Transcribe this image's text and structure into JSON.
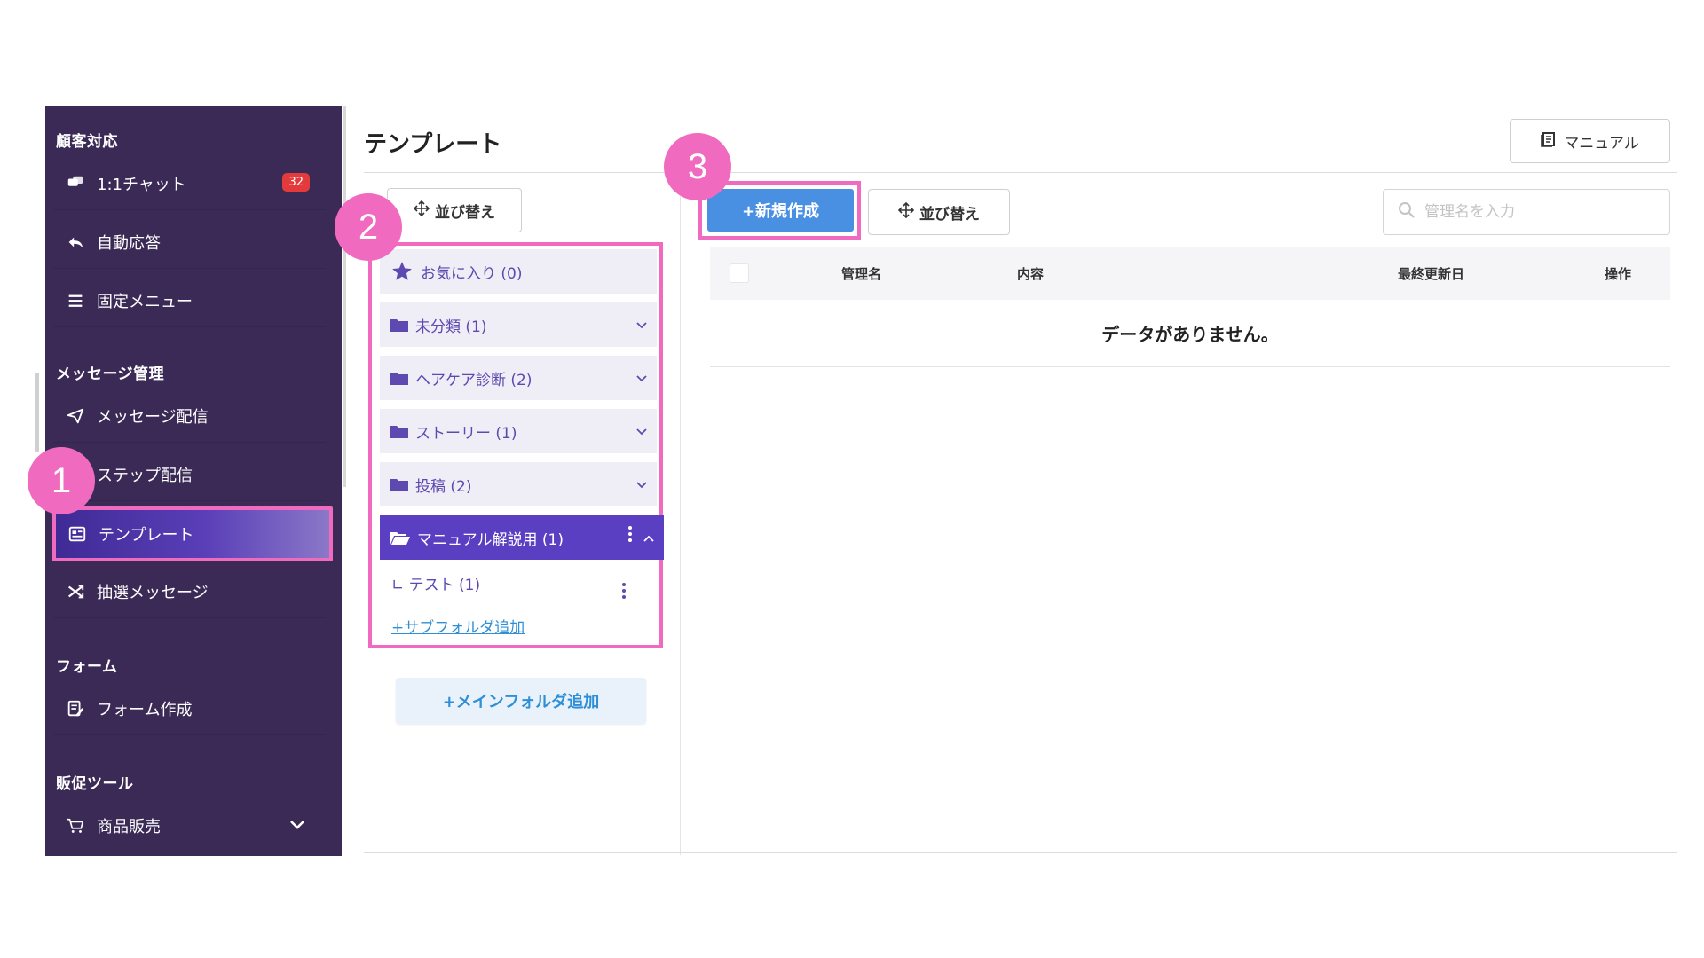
{
  "sidebar": {
    "sections": {
      "customer": "顧客対応",
      "message": "メッセージ管理",
      "form": "フォーム",
      "promo": "販促ツール"
    },
    "items": {
      "chat": {
        "label": "1:1チャット",
        "badge": "32"
      },
      "auto_reply": {
        "label": "自動応答"
      },
      "fixed_menu": {
        "label": "固定メニュー"
      },
      "message_delivery": {
        "label": "メッセージ配信"
      },
      "step_delivery": {
        "label": "ステップ配信"
      },
      "template": {
        "label": "テンプレート"
      },
      "lottery": {
        "label": "抽選メッセージ"
      },
      "form_create": {
        "label": "フォーム作成"
      },
      "product_sales": {
        "label": "商品販売"
      }
    }
  },
  "main": {
    "title": "テンプレート",
    "manual_label": "マニュアル",
    "sort_label": "並び替え",
    "new_label": "+新規作成",
    "search_placeholder": "管理名を入力",
    "folders": {
      "favorites": "お気に入り (0)",
      "uncategorized": "未分類 (1)",
      "haircare": "ヘアケア診断 (2)",
      "story": "ストーリー (1)",
      "post": "投稿 (2)",
      "manual": "マニュアル解説用 (1)"
    },
    "subfolder": "∟ テスト (1)",
    "add_subfolder": "+サブフォルダ追加",
    "add_main_folder": "+メインフォルダ追加",
    "table": {
      "headers": {
        "name": "管理名",
        "content": "内容",
        "updated": "最終更新日",
        "action": "操作"
      },
      "empty": "データがありません。"
    }
  },
  "callouts": [
    "1",
    "2",
    "3"
  ],
  "colors": {
    "sidebar": "#3a2a55",
    "accent": "#5a3fc3",
    "highlight": "#f06bc0",
    "primary": "#4a90e2"
  }
}
